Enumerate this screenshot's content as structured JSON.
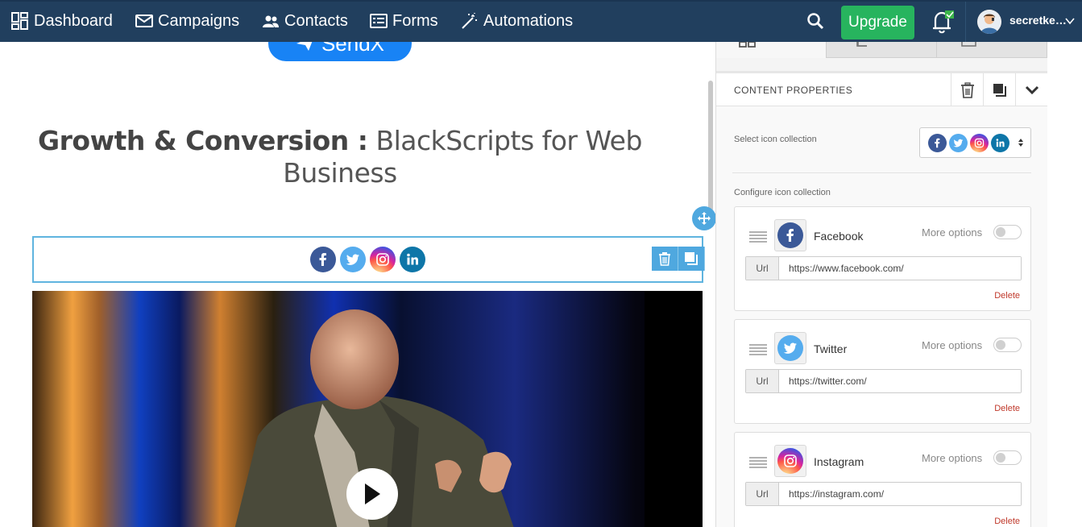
{
  "nav": {
    "dashboard": "Dashboard",
    "campaigns": "Campaigns",
    "contacts": "Contacts",
    "forms": "Forms",
    "automations": "Automations",
    "upgrade": "Upgrade",
    "user_name": "secretkeeper"
  },
  "canvas": {
    "sendx_label": "SendX",
    "heading_bold": "Growth & Conversion :",
    "heading_light": " BlackScripts for Web Business"
  },
  "panel": {
    "title": "CONTENT PROPERTIES",
    "select_label": "Select icon collection",
    "configure_label": "Configure icon collection",
    "items": [
      {
        "name": "Facebook",
        "more": "More options",
        "url_label": "Url",
        "url": "https://www.facebook.com/",
        "delete": "Delete"
      },
      {
        "name": "Twitter",
        "more": "More options",
        "url_label": "Url",
        "url": "https://twitter.com/",
        "delete": "Delete"
      },
      {
        "name": "Instagram",
        "more": "More options",
        "url_label": "Url",
        "url": "https://instagram.com/",
        "delete": "Delete"
      }
    ]
  },
  "colors": {
    "nav_bg": "#213f5e",
    "upgrade": "#27b45e",
    "facebook": "#3b5998",
    "twitter": "#55acee",
    "linkedin": "#0e76a8",
    "accent": "#4fa8df"
  }
}
